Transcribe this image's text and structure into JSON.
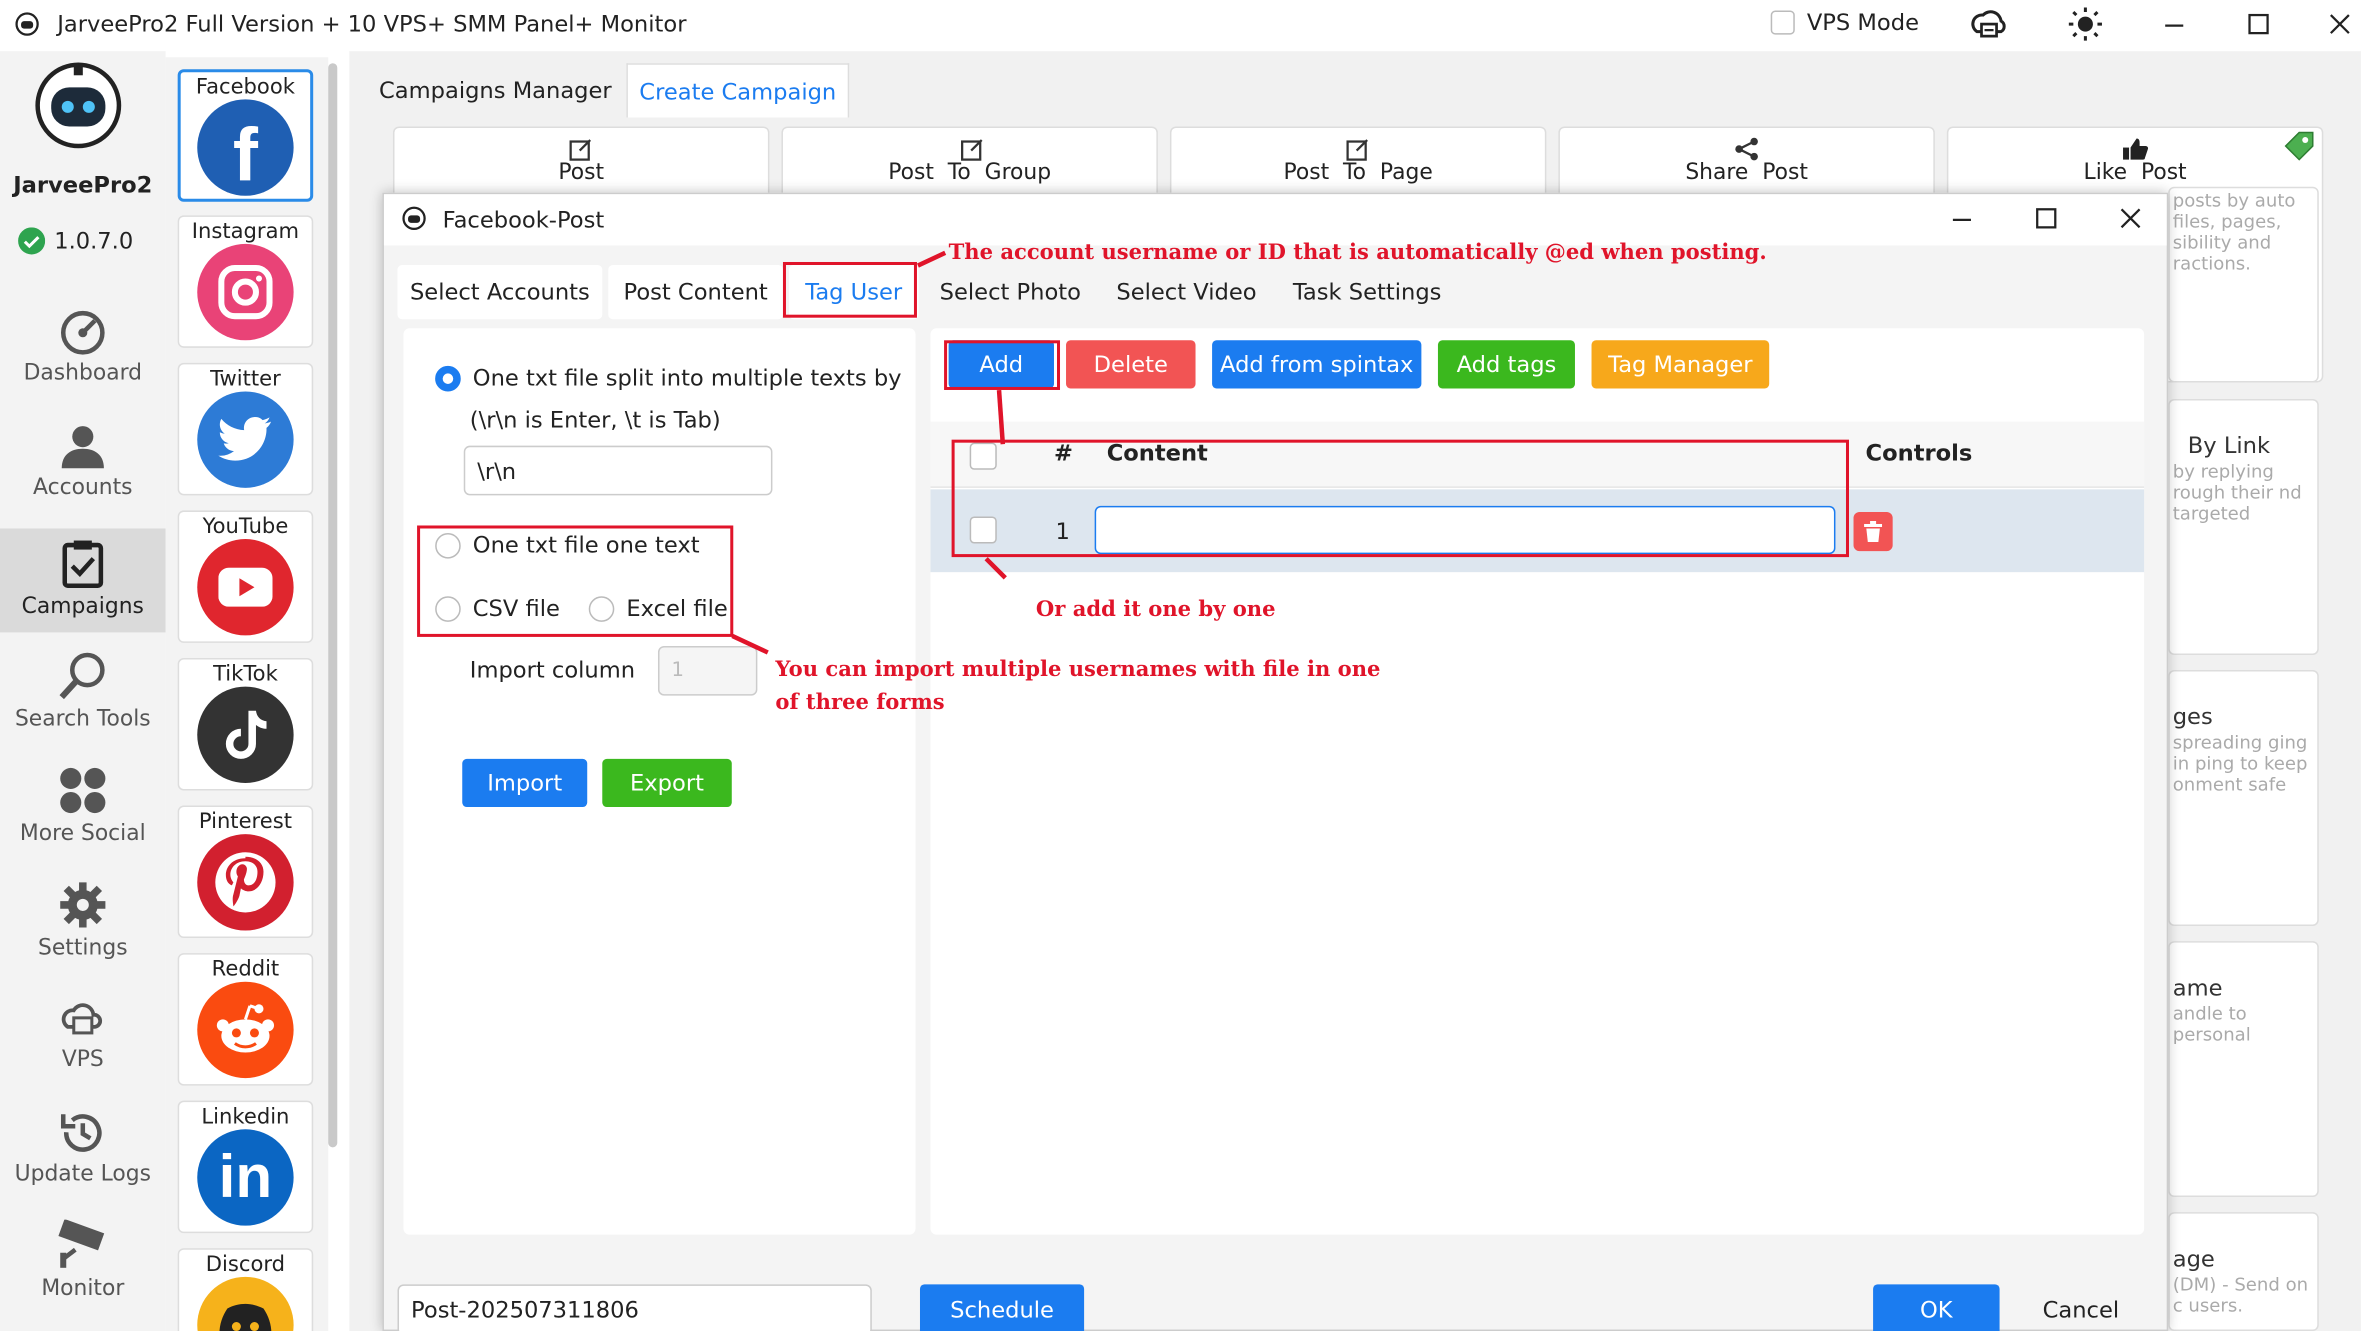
{
  "window": {
    "title": "JarveePro2 Full Version + 10 VPS+ SMM Panel+ Monitor",
    "vps_mode": "VPS Mode"
  },
  "app": {
    "name": "JarveePro2",
    "version": "1.0.7.0"
  },
  "nav": [
    {
      "label": "Dashboard",
      "icon": "dashboard-icon"
    },
    {
      "label": "Accounts",
      "icon": "user-icon"
    },
    {
      "label": "Campaigns",
      "icon": "clipboard-icon"
    },
    {
      "label": "Search Tools",
      "icon": "search-icon"
    },
    {
      "label": "More Social",
      "icon": "apps-icon"
    },
    {
      "label": "Settings",
      "icon": "gear-icon"
    },
    {
      "label": "VPS",
      "icon": "vps-icon"
    },
    {
      "label": "Update Logs",
      "icon": "history-icon"
    },
    {
      "label": "Monitor",
      "icon": "camera-icon"
    }
  ],
  "socials": [
    {
      "label": "Facebook",
      "color": "#1f5fb3"
    },
    {
      "label": "Instagram",
      "color": "#e94377"
    },
    {
      "label": "Twitter",
      "color": "#2d7bd6"
    },
    {
      "label": "YouTube",
      "color": "#e0262e"
    },
    {
      "label": "TikTok",
      "color": "#333333"
    },
    {
      "label": "Pinterest",
      "color": "#d2202f"
    },
    {
      "label": "Reddit",
      "color": "#fa4b10"
    },
    {
      "label": "Linkedin",
      "color": "#0b66c3"
    },
    {
      "label": "Discord",
      "color": "#f6b21b"
    }
  ],
  "main_tabs": [
    "Campaigns Manager",
    "Create Campaign"
  ],
  "campaign_cards": [
    "Post",
    "Post  To  Group",
    "Post  To  Page",
    "Share  Post",
    "Like  Post"
  ],
  "right_cards": [
    {
      "title": "",
      "desc": "posts by auto files, pages, sibility and ractions."
    },
    {
      "title": "By  Link",
      "desc": "by replying rough their nd targeted"
    },
    {
      "title": "ges",
      "desc": "spreading ging in ping to keep onment safe"
    },
    {
      "title": "ame",
      "desc": "andle to  personal"
    },
    {
      "title": "age",
      "desc": "(DM) - Send on c users."
    }
  ],
  "dialog": {
    "title": "Facebook-Post",
    "tabs": [
      "Select Accounts",
      "Post Content",
      "Tag User",
      "Select Photo",
      "Select Video",
      "Task Settings"
    ],
    "import": {
      "option_split": "One txt file split into multiple texts by",
      "option_split_hint": "(\\r\\n is Enter, \\t is Tab)",
      "separator_value": "\\r\\n",
      "option_one_text": "One txt file one text",
      "option_csv": "CSV file",
      "option_excel": "Excel file",
      "import_column_label": "Import column",
      "import_column_placeholder": "1",
      "import_button": "Import",
      "export_button": "Export"
    },
    "toolbar": {
      "add": "Add",
      "delete": "Delete",
      "add_from_spintax": "Add from spintax",
      "add_tags": "Add tags",
      "tag_manager": "Tag Manager"
    },
    "table": {
      "col_num": "#",
      "col_content": "Content",
      "col_controls": "Controls",
      "rows": [
        {
          "num": "1",
          "content": ""
        }
      ]
    },
    "footer": {
      "campaign_name": "Post-202507311806",
      "schedule": "Schedule",
      "ok": "OK",
      "cancel": "Cancel"
    }
  },
  "annotations": {
    "tag_user": "The account username or ID that is automatically @ed when posting.",
    "add_one": "Or add it one by one",
    "import_line1": "You can import multiple usernames with file in one",
    "import_line2": "of three forms"
  }
}
